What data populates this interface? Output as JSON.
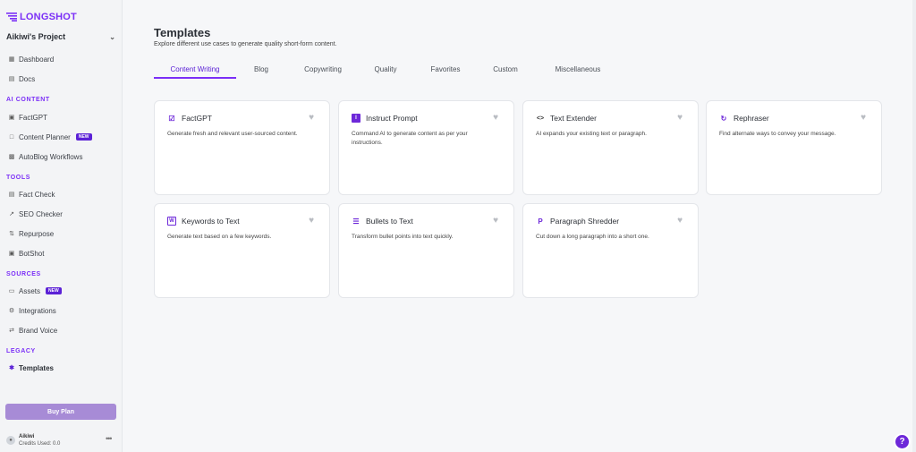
{
  "brand": {
    "name": "LONGSHOT"
  },
  "project": {
    "name": "Aikiwi's Project"
  },
  "sidebar": {
    "top_items": [
      {
        "label": "Dashboard",
        "icon": "dashboard-icon"
      },
      {
        "label": "Docs",
        "icon": "docs-icon"
      }
    ],
    "sections": [
      {
        "title": "AI CONTENT",
        "items": [
          {
            "label": "FactGPT",
            "icon": "factgpt-icon"
          },
          {
            "label": "Content Planner",
            "icon": "calendar-icon",
            "badge": "NEW"
          },
          {
            "label": "AutoBlog Workflows",
            "icon": "workflow-icon"
          }
        ]
      },
      {
        "title": "TOOLS",
        "items": [
          {
            "label": "Fact Check",
            "icon": "fact-check-icon"
          },
          {
            "label": "SEO Checker",
            "icon": "trend-icon"
          },
          {
            "label": "Repurpose",
            "icon": "repurpose-icon"
          },
          {
            "label": "BotShot",
            "icon": "bot-icon"
          }
        ]
      },
      {
        "title": "SOURCES",
        "items": [
          {
            "label": "Assets",
            "icon": "folder-icon",
            "badge": "NEW"
          },
          {
            "label": "Integrations",
            "icon": "gear-icon"
          },
          {
            "label": "Brand Voice",
            "icon": "arrows-icon"
          }
        ]
      },
      {
        "title": "LEGACY",
        "items": [
          {
            "label": "Templates",
            "icon": "puzzle-icon",
            "active": true
          }
        ]
      }
    ],
    "buy_plan": "Buy Plan",
    "user": {
      "name": "Aikiwi",
      "credits": "Credits Used: 0.0"
    }
  },
  "main": {
    "title": "Templates",
    "subtitle": "Explore different use cases to generate quality short-form content.",
    "tabs": [
      "Content Writing",
      "Blog",
      "Copywriting",
      "Quality",
      "Favorites",
      "Custom",
      "Miscellaneous"
    ],
    "active_tab": "Content Writing",
    "cards": [
      {
        "title": "FactGPT",
        "desc": "Generate fresh and relevant user-sourced content.",
        "icon": "factgpt-icon"
      },
      {
        "title": "Instruct Prompt",
        "desc": "Command AI to generate content as per your instructions.",
        "icon": "instruct-icon"
      },
      {
        "title": "Text Extender",
        "desc": "AI expands your existing text or paragraph.",
        "icon": "code-icon"
      },
      {
        "title": "Rephraser",
        "desc": "Find alternate ways to convey your message.",
        "icon": "refresh-icon"
      },
      {
        "title": "Keywords to Text",
        "desc": "Generate text based on a few keywords.",
        "icon": "keywords-icon"
      },
      {
        "title": "Bullets to Text",
        "desc": "Transform bullet points into text quickly.",
        "icon": "list-icon"
      },
      {
        "title": "Paragraph Shredder",
        "desc": "Cut down a long paragraph into a short one.",
        "icon": "paragraph-icon"
      }
    ]
  },
  "help": {
    "label": "?"
  },
  "colors": {
    "accent": "#7b2ff7",
    "badge": "#5b21d6",
    "buy_button": "#a78bd6"
  }
}
